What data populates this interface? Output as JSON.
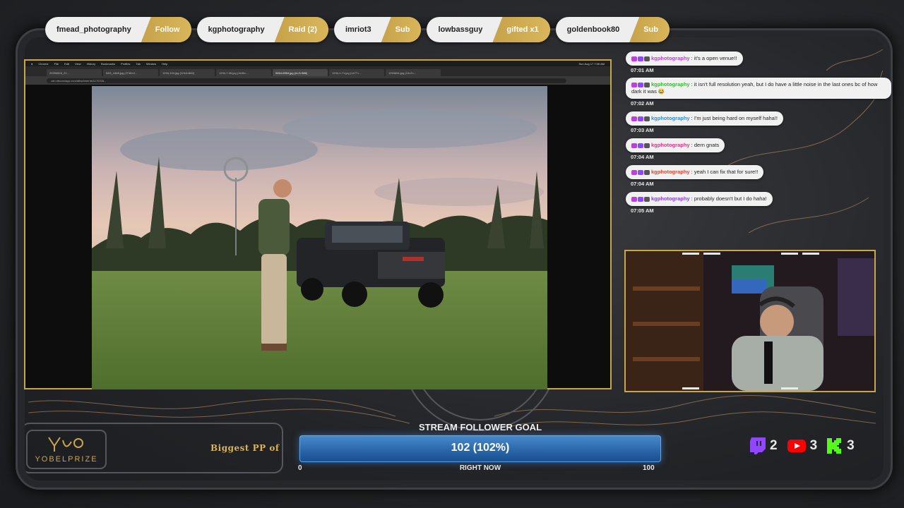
{
  "alerts": [
    {
      "name": "fmead_photography",
      "action": "Follow"
    },
    {
      "name": "kgphotography",
      "action": "Raid (2)"
    },
    {
      "name": "imriot3",
      "action": "Sub"
    },
    {
      "name": "lowbassguy",
      "action": "gifted x1"
    },
    {
      "name": "goldenbook80",
      "action": "Sub"
    }
  ],
  "browser": {
    "menu": [
      "Chrome",
      "File",
      "Edit",
      "View",
      "History",
      "Bookmarks",
      "Profiles",
      "Tab",
      "Window",
      "Help"
    ],
    "clock": "Sun Aug 17 7:06 AM",
    "tabs": [
      "20250816_21...",
      "IMG_4468.jpg (2748×2...",
      "1294-104.jpg (1248×883)",
      "1294-7-06.jpg (1640×...",
      "9654-6954.jpg (4×2×386)",
      "1294-1-71.jpg (1477×...",
      "1254694.jpg (24×2×..."
    ],
    "url": "cdn.discordapp.com/attachments/1170335..."
  },
  "chat": [
    {
      "user": "kgphotography",
      "user_color": "#c43ce0",
      "text": "it's a open venue!!",
      "time": "07:01 AM"
    },
    {
      "user": "kgphotography",
      "user_color": "#2fbf2f",
      "text": "it isn't full resolution yeah, but I do have a little noise in the last ones bc of how dark it was 😂",
      "time": "07:02 AM"
    },
    {
      "user": "kgphotography",
      "user_color": "#2a8fd6",
      "text": "I'm just being hard on myself haha!!",
      "time": "07:03 AM"
    },
    {
      "user": "kgphotography",
      "user_color": "#e0308a",
      "text": "dern gnats",
      "time": "07:04 AM"
    },
    {
      "user": "kgphotography",
      "user_color": "#e0442a",
      "text": "yeah I can fix that for sure!!",
      "time": "07:04 AM"
    },
    {
      "user": "kgphotography",
      "user_color": "#8a3ae0",
      "text": "probably doesn't but I do haha!",
      "time": "07:05 AM"
    }
  ],
  "brand": {
    "name": "YOBELPRIZE"
  },
  "ticker": {
    "text": "Biggest PP of"
  },
  "goal": {
    "title": "STREAM FOLLOWER GOAL",
    "value_text": "102 (102%)",
    "progress": 1.0,
    "min": "0",
    "max": "100",
    "center_label": "RIGHT NOW"
  },
  "viewer_counts": [
    {
      "platform": "twitch-icon",
      "count": "2",
      "color": "#9146ff"
    },
    {
      "platform": "youtube-icon",
      "count": "3",
      "color": "#ff0000"
    },
    {
      "platform": "kick-icon",
      "count": "3",
      "color": "#53fc18"
    }
  ]
}
